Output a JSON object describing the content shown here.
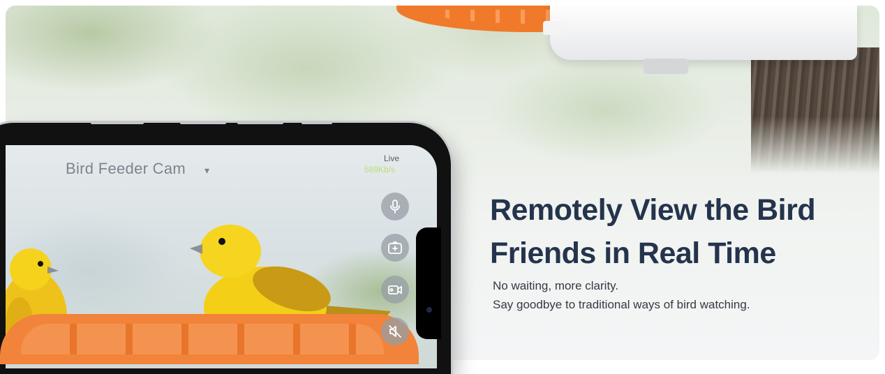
{
  "camera": {
    "title": "Bird Feeder Cam",
    "caret": "▾",
    "live_label": "Live",
    "bitrate": "589Kb/s"
  },
  "controls": [
    {
      "icon": "microphone-icon"
    },
    {
      "icon": "snapshot-icon"
    },
    {
      "icon": "record-video-icon"
    },
    {
      "icon": "speaker-mute-icon"
    }
  ],
  "headline": {
    "line1": "Remotely View the Bird",
    "line2": "Friends in Real Time"
  },
  "subtext": {
    "line1": "No waiting, more clarity.",
    "line2": "Say goodbye to traditional ways of bird watching."
  },
  "colors": {
    "accent_orange": "#f07a2a",
    "headline": "#24344d",
    "bitrate_green": "#b8e07a",
    "bird_yellow": "#f5d21b"
  }
}
